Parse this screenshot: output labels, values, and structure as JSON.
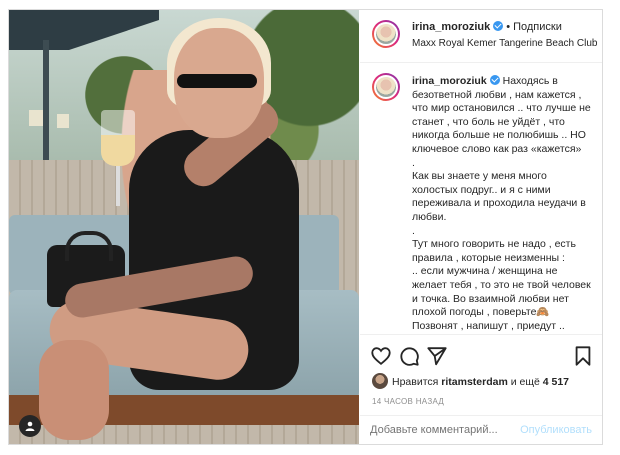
{
  "post": {
    "username": "irina_moroziuk",
    "follow_label": "Подписки",
    "location": "Maxx Royal Kemer Tangerine Beach Club",
    "caption_username": "irina_moroziuk",
    "caption_lines": [
      "Находясь в безответной любви , нам кажется , что мир остановился .. что лучше не станет , что боль не уйдёт , что никогда больше не полюбишь .. НО ключевое слово как раз «кажется»",
      ".",
      "Как вы знаете у меня много холостых подруг.. и я с ними переживала и проходила неудачи в любви.",
      ".",
      "Тут много говорить не надо , есть правила , которые неизменны :",
      ".. если мужчина / женщина не желает тебя , то это не твой человек и точка. Во взаимной любви нет плохой погоды , поверьте🙈",
      "Позвонят , напишут , приедут .."
    ],
    "likes_prefix": "Нравится",
    "likes_user": "ritamsterdam",
    "likes_middle": "и ещё",
    "likes_count": "4 517",
    "timestamp": "14 ЧАСОВ НАЗАД",
    "comment_placeholder": "Добавьте комментарий...",
    "publish_label": "Опубликовать"
  },
  "icons": [
    "heart-icon",
    "comment-icon",
    "share-icon",
    "bookmark-icon",
    "user-tag-icon",
    "verified-badge-icon"
  ],
  "colors": {
    "verified": "#3897f0",
    "publish_disabled": "#b2dffc",
    "muted": "#8e8e8e",
    "border": "#dbdbdb"
  }
}
